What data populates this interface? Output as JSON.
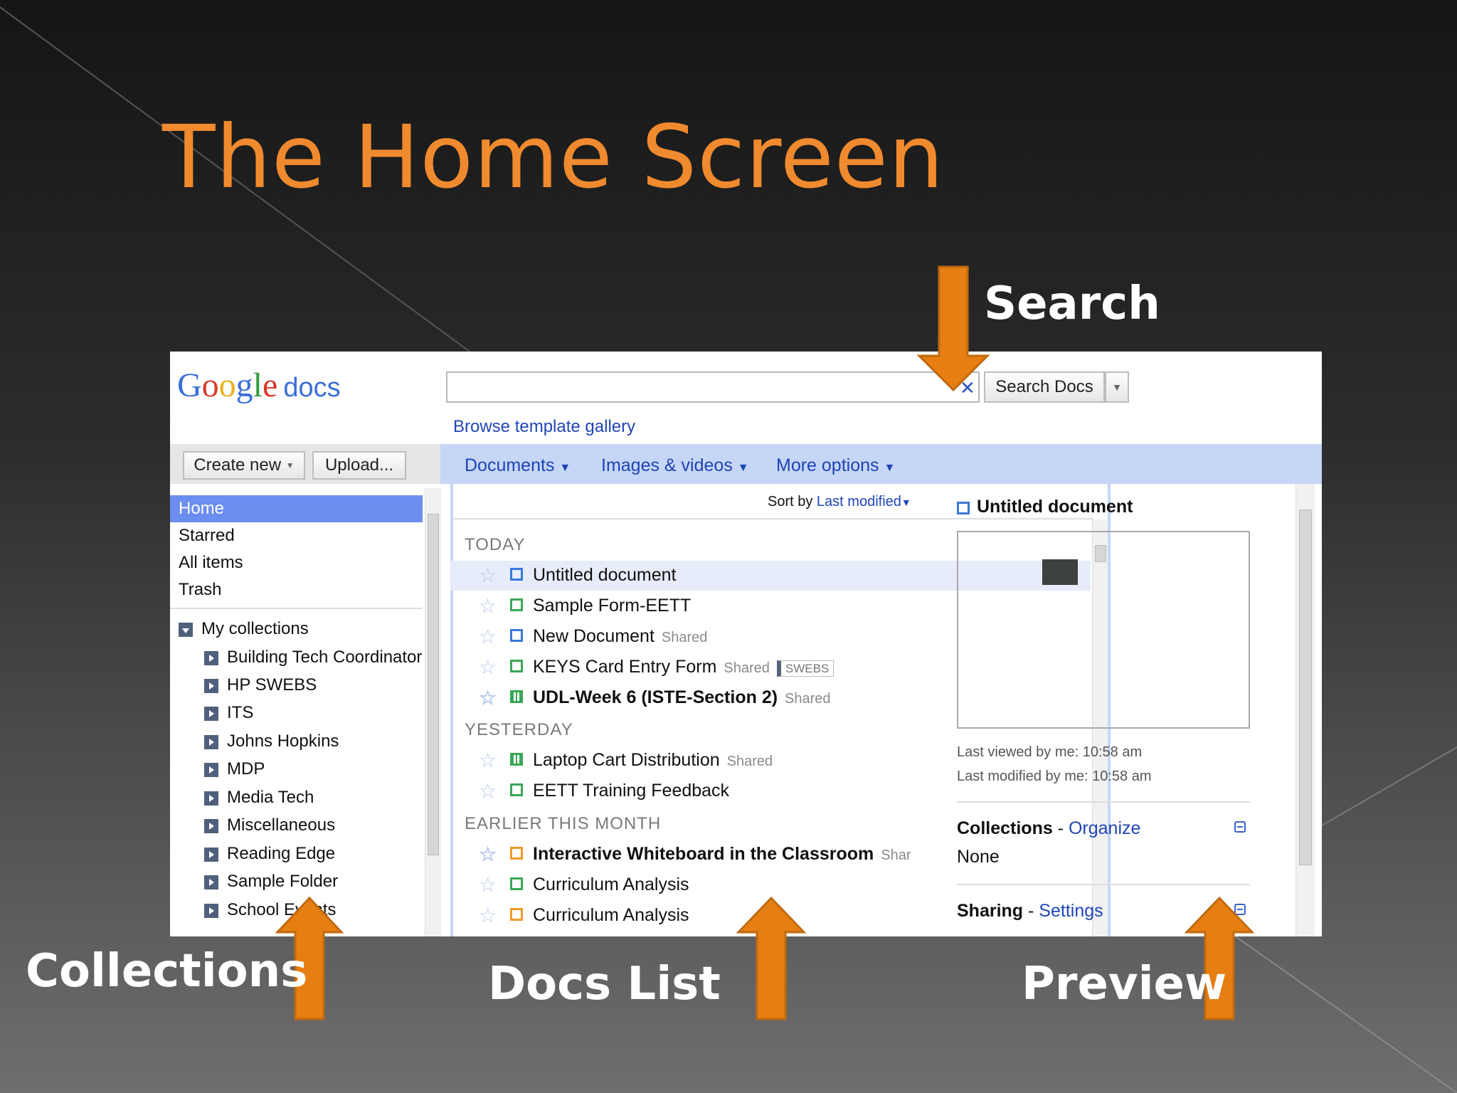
{
  "slide": {
    "title": "The Home Screen",
    "callouts": {
      "search": "Search",
      "collections": "Collections",
      "docs_list": "Docs List",
      "preview": "Preview"
    }
  },
  "colors": {
    "title": "#f08a2e",
    "arrow": "#e67e12",
    "selection": "#6b8ef0",
    "link": "#2046b8",
    "toolbar": "#c6d6f6"
  },
  "app": {
    "logo_google": "Google",
    "logo_docs": "docs",
    "search": {
      "value": "",
      "placeholder": "",
      "clear_icon": "close-icon",
      "button": "Search Docs"
    },
    "browse_templates": "Browse template gallery",
    "create_new": "Create new",
    "upload": "Upload...",
    "menus": [
      "Documents",
      "Images & videos",
      "More options"
    ],
    "sort": {
      "label": "Sort by",
      "value": "Last modified"
    },
    "nav": [
      "Home",
      "Starred",
      "All items",
      "Trash"
    ],
    "my_collections": "My collections",
    "collections": [
      "Building Tech Coordinator",
      "HP SWEBS",
      "ITS",
      "Johns Hopkins",
      "MDP",
      "Media Tech",
      "Miscellaneous",
      "Reading Edge",
      "Sample Folder",
      "School Events"
    ],
    "groups": {
      "today": "TODAY",
      "yesterday": "YESTERDAY",
      "earlier": "EARLIER THIS MONTH"
    },
    "docs": [
      {
        "name": "Untitled document",
        "shared": "",
        "tag": "",
        "icon": "document-icon"
      },
      {
        "name": "Sample Form-EETT",
        "shared": "",
        "tag": "",
        "icon": "form-icon"
      },
      {
        "name": "New Document",
        "shared": "Shared",
        "tag": "",
        "icon": "document-icon"
      },
      {
        "name": "KEYS Card Entry Form",
        "shared": "Shared",
        "tag": "SWEBS",
        "icon": "form-icon"
      },
      {
        "name": "UDL-Week 6 (ISTE-Section 2)",
        "shared": "Shared",
        "tag": "",
        "icon": "spreadsheet-icon"
      },
      {
        "name": "Laptop Cart Distribution",
        "shared": "Shared",
        "tag": "",
        "icon": "spreadsheet-icon"
      },
      {
        "name": "EETT Training Feedback",
        "shared": "",
        "tag": "",
        "icon": "form-icon"
      },
      {
        "name": "Interactive Whiteboard in the Classroom",
        "shared": "Shar",
        "tag": "",
        "icon": "presentation-icon"
      },
      {
        "name": "Curriculum Analysis",
        "shared": "",
        "tag": "",
        "icon": "form-icon"
      },
      {
        "name": "Curriculum Analysis",
        "shared": "",
        "tag": "",
        "icon": "presentation-icon"
      }
    ],
    "preview": {
      "title": "Untitled document",
      "last_viewed": "Last viewed by me: 10:58 am",
      "last_modified": "Last modified by me: 10:58 am",
      "collections_label": "Collections",
      "collections_link": "Organize",
      "collections_value": "None",
      "sharing_label": "Sharing",
      "sharing_link": "Settings"
    }
  }
}
